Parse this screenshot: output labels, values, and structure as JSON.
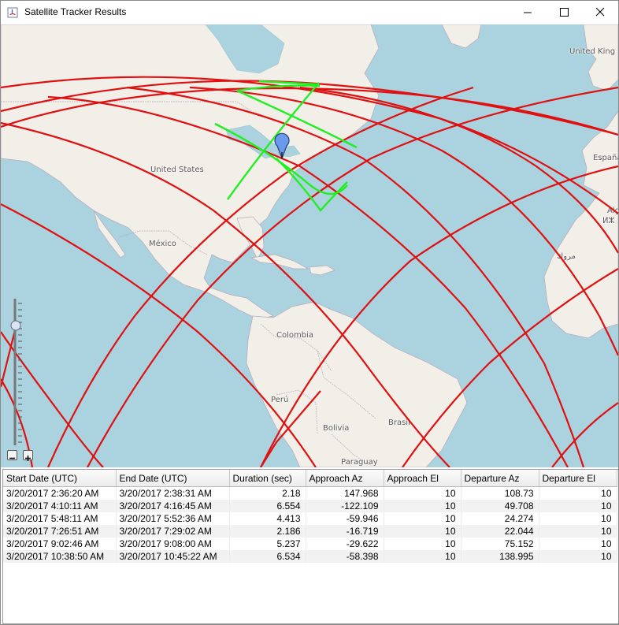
{
  "window": {
    "title": "Satellite Tracker Results"
  },
  "map": {
    "labels": {
      "united_states": "United States",
      "mexico": "México",
      "colombia": "Colombia",
      "peru": "Perú",
      "bolivia": "Bolivia",
      "brasil": "Brasil",
      "paraguay": "Paraguay",
      "united_kingdom": "United King",
      "espana": "España",
      "algeria": "Alg",
      "algeria_tifinagh": "ⵍⵣ",
      "morocco_ar": "مروك"
    },
    "colors": {
      "water": "#aad3df",
      "land": "#f2efe9",
      "ground_track": "#e01010",
      "visible_pass": "#22ee22",
      "marker": "#6a9aee"
    },
    "marker_icon": "map-pin-icon"
  },
  "table": {
    "columns": [
      "Start Date (UTC)",
      "End Date (UTC)",
      "Duration (sec)",
      "Approach Az",
      "Approach El",
      "Departure Az",
      "Departure El"
    ],
    "rows": [
      [
        "3/20/2017 2:36:20 AM",
        "3/20/2017 2:38:31 AM",
        "2.18",
        "147.968",
        "10",
        "108.73",
        "10"
      ],
      [
        "3/20/2017 4:10:11 AM",
        "3/20/2017 4:16:45 AM",
        "6.554",
        "-122.109",
        "10",
        "49.708",
        "10"
      ],
      [
        "3/20/2017 5:48:11 AM",
        "3/20/2017 5:52:36 AM",
        "4.413",
        "-59.946",
        "10",
        "24.274",
        "10"
      ],
      [
        "3/20/2017 7:26:51 AM",
        "3/20/2017 7:29:02 AM",
        "2.186",
        "-16.719",
        "10",
        "22.044",
        "10"
      ],
      [
        "3/20/2017 9:02:46 AM",
        "3/20/2017 9:08:00 AM",
        "5.237",
        "-29.622",
        "10",
        "75.152",
        "10"
      ],
      [
        "3/20/2017 10:38:50 AM",
        "3/20/2017 10:45:22 AM",
        "6.534",
        "-58.398",
        "10",
        "138.995",
        "10"
      ]
    ]
  }
}
